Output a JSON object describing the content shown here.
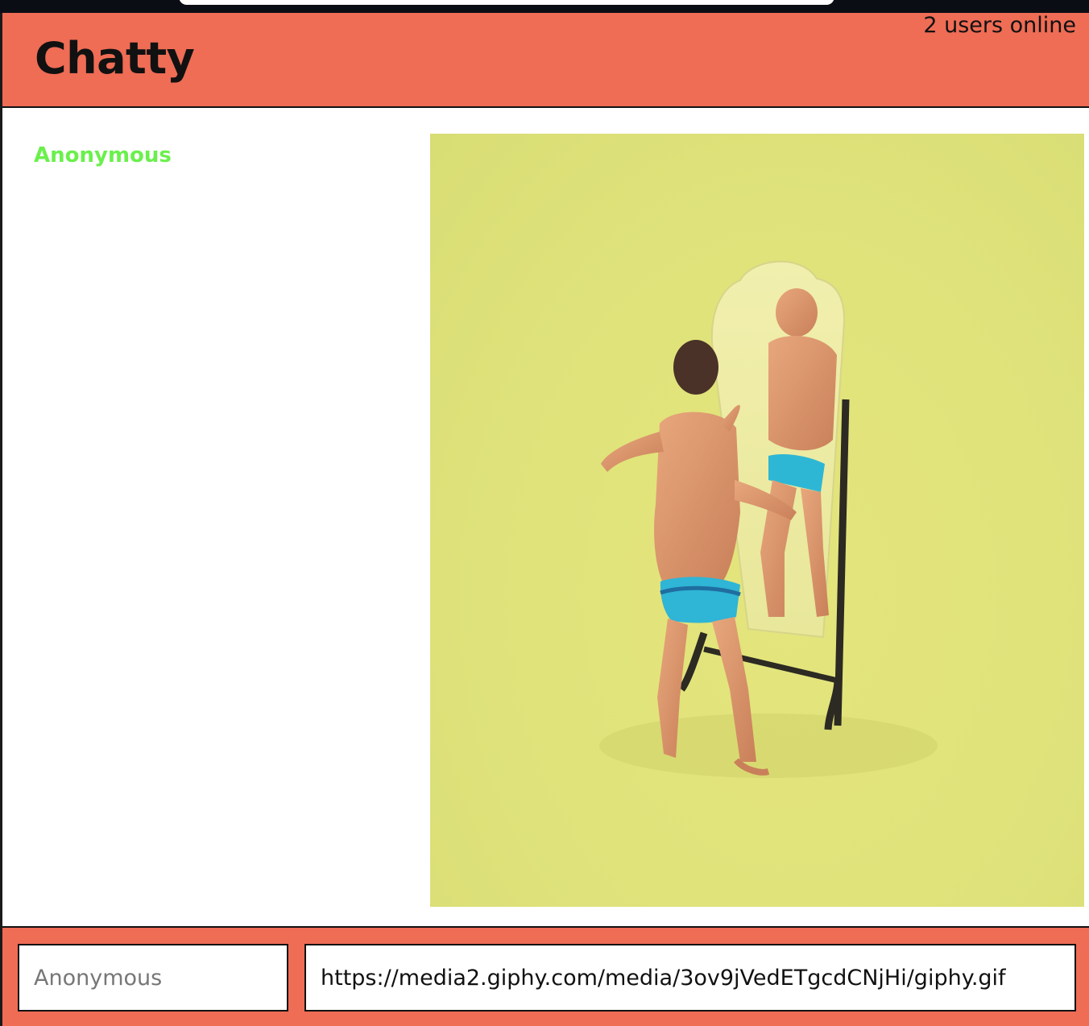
{
  "navbar": {
    "brand": "Chatty",
    "user_count": "2 users online"
  },
  "messages": [
    {
      "username": "Anonymous",
      "username_color": "#6af04c",
      "image_description_icon": "toy-figure-mirror-gif"
    }
  ],
  "chatbar": {
    "username_placeholder": "Anonymous",
    "username_value": "",
    "message_value": "https://media2.giphy.com/media/3ov9jVedETgcdCNjHi/giphy.gif",
    "message_placeholder": ""
  },
  "colors": {
    "accent": "#ef6c55",
    "username_green": "#6af04c",
    "image_background": "#dfe27a"
  }
}
